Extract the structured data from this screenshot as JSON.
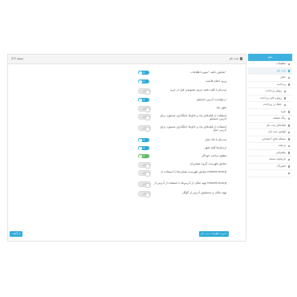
{
  "panel": {
    "title": "ثبت نام",
    "badge": "نسخه 3.0"
  },
  "settings": [
    {
      "label": "نمایش دکمه \"سوره اطلاعات\"",
      "state": "on",
      "toggle_text": "بله"
    },
    {
      "label": "ورود اعلام قابلیت",
      "state": "on",
      "toggle_text": "بله"
    },
    {
      "label": "ثبت‌نام با کلید دفعه حریم خصوصی قبل از خرید",
      "state": "off",
      "toggle_text": "خیر"
    },
    {
      "label": "درخواست آدرس جستجو",
      "state": "on",
      "toggle_text": "بله"
    },
    {
      "label": "شهر بیاد",
      "state": "off",
      "toggle_text": "خیر"
    },
    {
      "label": "استفاده از فیلدهای بیاد و جای‌ها جایگذاری مستورد برای آدرس جستجو",
      "state": "off",
      "toggle_text": "خیر"
    },
    {
      "label": "استفاده از فیلدهای بیاد و جای‌ها جایگذاری مستورد برای آدرس حمل",
      "state": "off",
      "toggle_text": "خیر"
    },
    {
      "label": "ثبت‌نام با تالا حمل",
      "state": "on",
      "toggle_text": "بله"
    },
    {
      "label": "ارسال‌ها کلید شهر",
      "state": "on",
      "toggle_text": "بله"
    },
    {
      "label": "تنظیم ساعت خودکار",
      "state": "green",
      "toggle_text": "بله"
    },
    {
      "label": "نمایش فهرست گروه مشتریان",
      "state": "off",
      "toggle_text": "خیر"
    },
    {
      "label": "نمایش فهرست شماره‌ها با استفاده از maxmind.org",
      "state": "off",
      "toggle_text": "خیر"
    },
    {
      "label": "تهیه مکان از آدرس‌ها با استفاده از آدرس از maxmind.org",
      "state": "off",
      "toggle_text": "خیر"
    },
    {
      "label": "تهیه مکان و جستجوی آدرس از گوگل",
      "state": "off",
      "toggle_text": "خیر"
    }
  ],
  "buttons": {
    "save": "ذخیره تنظیمات ثبت نام",
    "back": "بازگشت"
  },
  "sidebar": {
    "header": "منو",
    "items": [
      {
        "label": "تنظیمات",
        "sub": false,
        "active": false
      },
      {
        "label": "ثبت نام",
        "sub": false,
        "active": true
      },
      {
        "label": "حمل",
        "sub": false,
        "active": false
      },
      {
        "label": "پرداخت",
        "sub": false,
        "active": false
      },
      {
        "label": "روش پرداخت",
        "sub": true,
        "active": false
      },
      {
        "label": "روش های پرداخت",
        "sub": true,
        "active": false
      },
      {
        "label": "خطا در پرداخت",
        "sub": true,
        "active": false
      },
      {
        "label": "تایید",
        "sub": false,
        "active": false
      },
      {
        "label": "رنگ صفحه",
        "sub": false,
        "active": false
      },
      {
        "label": "فیلدهای ثبت نام",
        "sub": false,
        "active": false
      },
      {
        "label": "قوانین ثبت نام",
        "sub": false,
        "active": false
      },
      {
        "label": "مسئله های اجتماعی",
        "sub": false,
        "active": false
      },
      {
        "label": "ترجمه",
        "sub": false,
        "active": false
      },
      {
        "label": "پشتیبانی",
        "sub": false,
        "active": false
      },
      {
        "label": "تاریخچه نسخه",
        "sub": false,
        "active": false
      },
      {
        "label": "اشتراک",
        "sub": false,
        "active": false
      },
      {
        "label": "",
        "sub": false,
        "active": false
      }
    ]
  }
}
